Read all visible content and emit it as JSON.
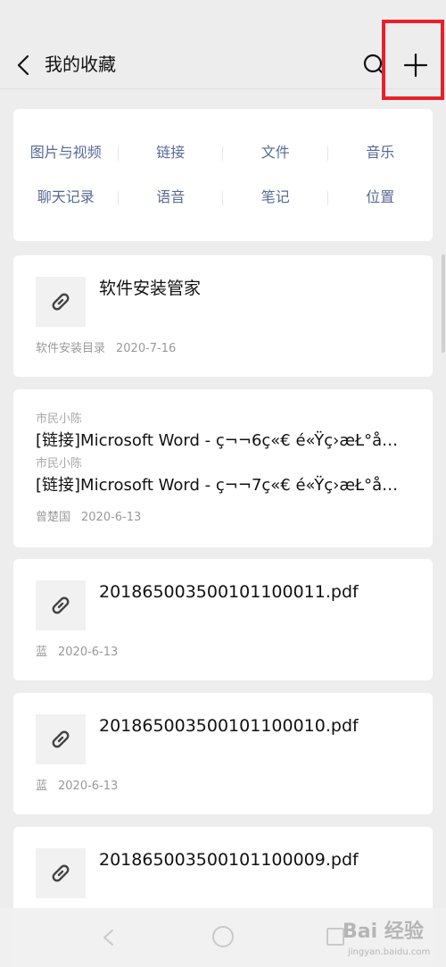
{
  "header": {
    "title": "我的收藏",
    "back_icon": "chevron-left-icon",
    "search_icon": "search-icon",
    "add_icon": "plus-icon",
    "highlight_color": "#e8202a"
  },
  "categories": {
    "row1": [
      "图片与视频",
      "链接",
      "文件",
      "音乐"
    ],
    "row2": [
      "聊天记录",
      "语音",
      "笔记",
      "位置"
    ],
    "color": "#576b95"
  },
  "items": [
    {
      "title": "软件安装管家",
      "source": "软件安装目录",
      "date": "2020-7-16",
      "icon": "link-icon"
    },
    {
      "type": "chat",
      "messages": [
        {
          "sender": "市民小陈",
          "text": "[链接]Microsoft Word - ç¬¬6ç«€ é«Ÿç›æŁ°å…"
        },
        {
          "sender": "市民小陈",
          "text": "[链接]Microsoft Word - ç¬¬7ç«€ é«Ÿç›æŁ°å…"
        }
      ],
      "source": "曾楚国",
      "date": "2020-6-13"
    },
    {
      "title": "201865003500101100011.pdf",
      "source": "蓝",
      "date": "2020-6-13",
      "icon": "link-icon"
    },
    {
      "title": "201865003500101100010.pdf",
      "source": "蓝",
      "date": "2020-6-13",
      "icon": "link-icon"
    },
    {
      "title": "201865003500101100009.pdf",
      "icon": "link-icon"
    }
  ],
  "watermark": {
    "main": "Bai 经验",
    "sub": "jingyan.baidu.com"
  }
}
